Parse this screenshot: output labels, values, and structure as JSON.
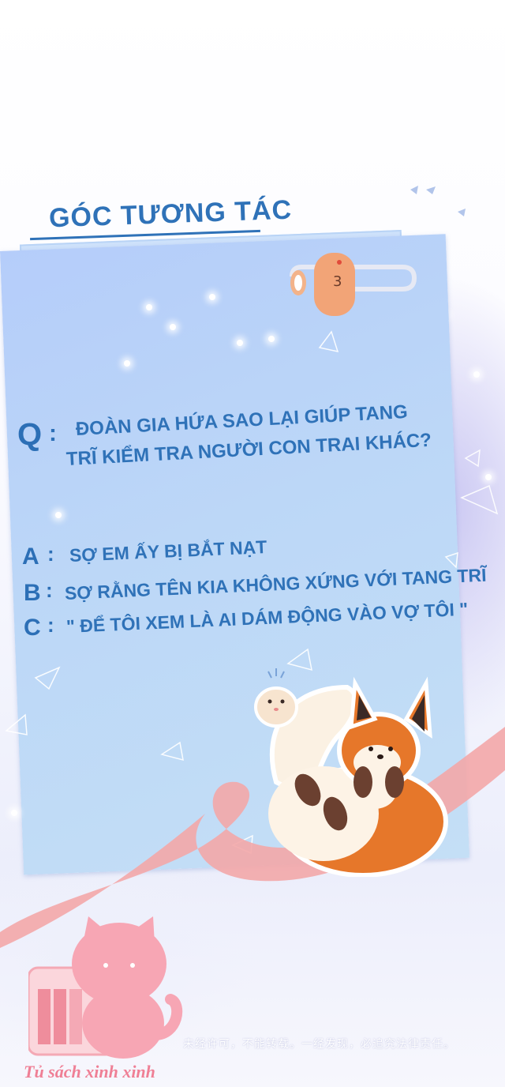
{
  "header": {
    "title": "GÓC TƯƠNG TÁC"
  },
  "question": {
    "label": "Q",
    "colon": ":",
    "line1": "ĐOÀN GIA HỨA SAO LẠI GIÚP TANG",
    "line2": "TRĨ KIỂM TRA NGƯỜI CON TRAI KHÁC?"
  },
  "answers": [
    {
      "label": "A",
      "colon": ":",
      "text": "SỢ EM ẤY BỊ BẮT NẠT"
    },
    {
      "label": "B",
      "colon": ":",
      "text": "SỢ RẰNG TÊN KIA KHÔNG XỨNG VỚI TANG TRĨ"
    },
    {
      "label": "C",
      "colon": ":",
      "text": "\" ĐỂ TÔI XEM LÀ AI DÁM ĐỘNG VÀO VỢ TÔI \""
    }
  ],
  "watermark": "未经许可，不能转载。一经发现，必追究法律责任。",
  "brand": "Tủ sách xinh xinh",
  "colors": {
    "accent": "#2f72b8",
    "card": "#bcd7f7",
    "ribbon": "#f3a7a9",
    "brand": "#ef7f95"
  },
  "icons": [
    "fox-illustration",
    "hamster-illustration",
    "paperclip-icon",
    "pink-cat-logo"
  ]
}
